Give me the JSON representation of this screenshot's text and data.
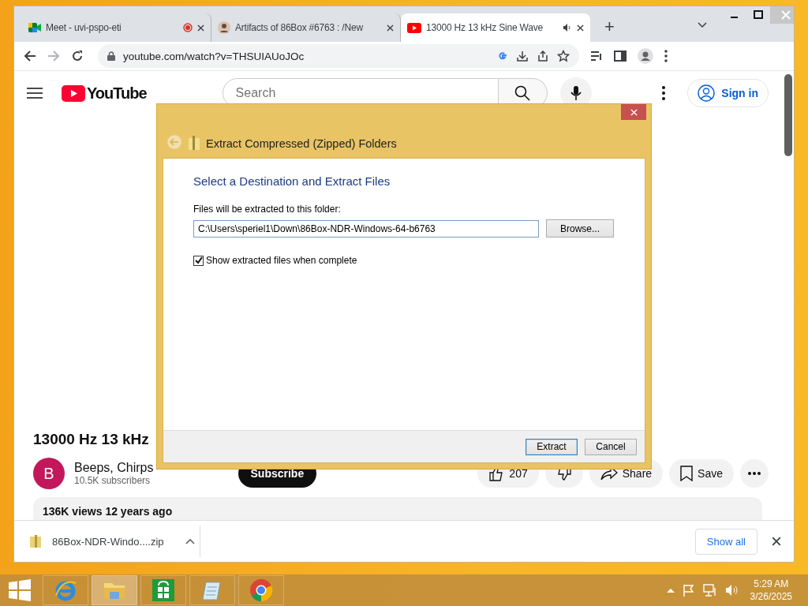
{
  "browser": {
    "tabs": [
      {
        "kind": "meet",
        "title": "Meet - uvi-pspo-eti",
        "recording": true,
        "audio": false,
        "selected": false
      },
      {
        "kind": "avatar",
        "title": "Artifacts of 86Box #6763 : /New",
        "recording": false,
        "audio": false,
        "selected": false
      },
      {
        "kind": "video",
        "title": "13000 Hz 13 kHz Sine Wave",
        "recording": false,
        "audio": true,
        "selected": true
      }
    ],
    "new_tab": "+",
    "address": "youtube.com/watch?v=THSUIAUoJOc"
  },
  "youtube": {
    "search_placeholder": "Search",
    "sign_in": "Sign in",
    "logo_text": "YouTube",
    "video_title": "13000 Hz 13 kHz",
    "channel_initial": "B",
    "channel_name": "Beeps, Chirps",
    "subscribers": "10.5K subscribers",
    "subscribe": "Subscribe",
    "likes": "207",
    "share": "Share",
    "save": "Save",
    "description": "136K views  12 years ago"
  },
  "dialog": {
    "title": "Extract Compressed (Zipped) Folders",
    "heading": "Select a Destination and Extract Files",
    "folder_label": "Files will be extracted to this folder:",
    "folder_value": "C:\\Users\\speriel1\\Down\\86Box-NDR-Windows-64-b6763",
    "browse": "Browse...",
    "show_files": {
      "label": "Show extracted files when complete",
      "checked": true
    },
    "buttons": [
      {
        "label": "Extract",
        "focused": true
      },
      {
        "label": "Cancel",
        "focused": false
      }
    ]
  },
  "downloads": {
    "file": "86Box-NDR-Windo....zip",
    "show_all": "Show all"
  },
  "taskbar": {
    "apps": [
      {
        "kind": "ie",
        "selected": false
      },
      {
        "kind": "explorer",
        "selected": true
      },
      {
        "kind": "store",
        "selected": false
      },
      {
        "kind": "notepad",
        "selected": false
      },
      {
        "kind": "chrome",
        "selected": false
      }
    ],
    "time": "5:29 AM",
    "date": "3/26/2025"
  }
}
